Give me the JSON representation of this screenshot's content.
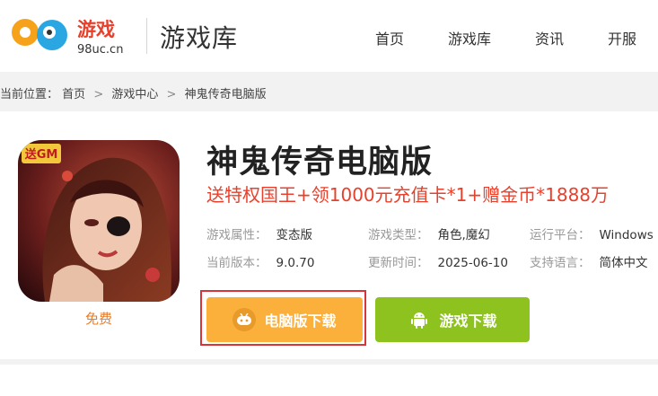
{
  "header": {
    "logo_mark": "98",
    "logo_text": "游戏",
    "logo_domain": "98uc.cn",
    "section_title": "游戏库",
    "nav": [
      "首页",
      "游戏库",
      "资讯",
      "开服"
    ]
  },
  "breadcrumb": {
    "prefix": "当前位置：",
    "items": [
      "首页",
      "游戏中心",
      "神鬼传奇电脑版"
    ],
    "separator": ">"
  },
  "game": {
    "cover_badge": "送GM",
    "price_label": "免费",
    "title": "神鬼传奇电脑版",
    "promo": "送特权国王+领1000元充值卡*1+赠金币*1888万",
    "info": [
      {
        "key": "游戏属性：",
        "value": "变态版"
      },
      {
        "key": "游戏类型：",
        "value": "角色,魔幻"
      },
      {
        "key": "运行平台：",
        "value": "Windows"
      },
      {
        "key": "当前版本：",
        "value": "9.0.70"
      },
      {
        "key": "更新时间：",
        "value": "2025-06-10"
      },
      {
        "key": "支持语言：",
        "value": "简体中文"
      }
    ]
  },
  "buttons": {
    "pc_download": "电脑版下载",
    "game_download": "游戏下载"
  },
  "colors": {
    "accent_orange": "#fbb03b",
    "accent_green": "#8dc21f",
    "promo_red": "#e8402c",
    "highlight_red": "#d8343a"
  },
  "icons": {
    "pc_button": "gamepad-icon",
    "game_button": "android-icon"
  }
}
